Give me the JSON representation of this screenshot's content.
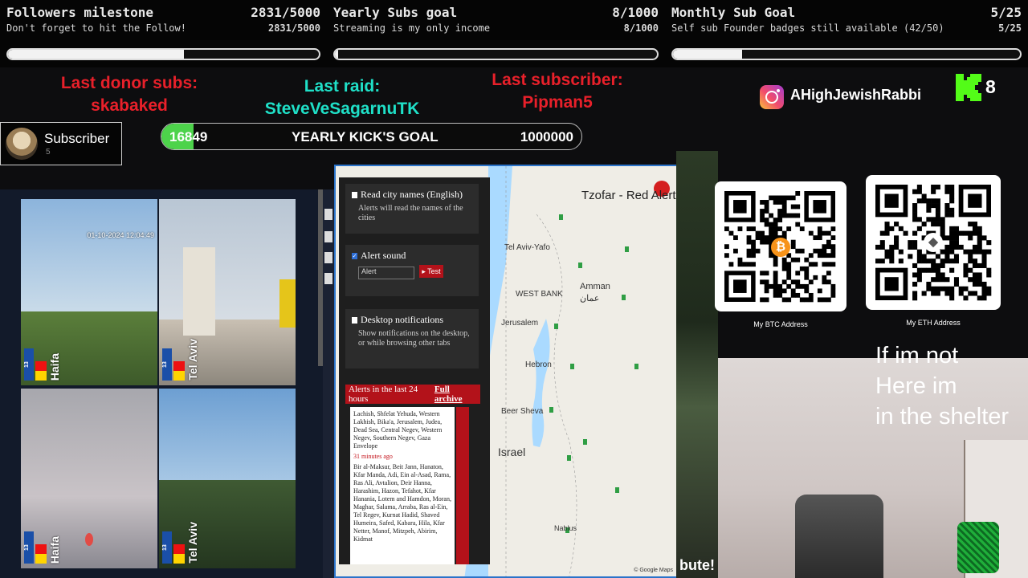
{
  "goals": [
    {
      "title": "Followers milestone",
      "count": "2831/5000",
      "subtitle": "Don't forget to hit the Follow!",
      "count2": "2831/5000",
      "progress": 0.566
    },
    {
      "title": "Yearly Subs goal",
      "count": "8/1000",
      "subtitle": "Streaming is my only income",
      "count2": "8/1000",
      "progress": 0.008
    },
    {
      "title": "Monthly Sub Goal",
      "count": "5/25",
      "subtitle": "Self sub Founder badges still available (42/50)",
      "count2": "5/25",
      "progress": 0.2
    }
  ],
  "events": {
    "donor_label": "Last donor subs:",
    "donor_name": "skabaked",
    "raid_label": "Last raid:",
    "raid_name": "SteveVeSagarnuTK",
    "sub_label": "Last subscriber:",
    "sub_name": "Pipman5"
  },
  "subscriber_card": {
    "title": "Subscriber",
    "count": "5"
  },
  "kick_goal": {
    "current": "16849",
    "label": "YEARLY KICK'S GOAL",
    "target": "1000000",
    "progress": 0.016849
  },
  "social": {
    "instagram_handle": "AHighJewishRabbi",
    "kick_count": "8",
    "icons": [
      "instagram-icon",
      "kick-logo-icon"
    ]
  },
  "cameras": [
    {
      "city": "Haifa",
      "timestamp": "01-10-2024 12:04:49"
    },
    {
      "city": "Tel Aviv",
      "timestamp": ""
    },
    {
      "city": "Haifa",
      "timestamp": ""
    },
    {
      "city": "Tel Aviv",
      "timestamp": ""
    }
  ],
  "camera_badge": "13",
  "alert_app": {
    "read_city_names": "Read city names (English)",
    "read_city_desc": "Alerts will read the names of the cities",
    "alert_sound": "Alert sound",
    "sound_select": "Alert",
    "test_button": "Test",
    "desktop_notifications": "Desktop notifications",
    "desktop_desc": "Show notifications on the desktop, or while browsing other tabs",
    "alerts_header": "Alerts in the last 24 hours",
    "full_archive": "Full archive",
    "alerts_text_1": "Lachish, Shfelat Yehuda, Western Lakhish, Bika'a, Jerusalem, Judea, Dead Sea, Central Negev, Western Negev, Southern Negev, Gaza Envelope",
    "alerts_time": "31 minutes ago",
    "alerts_text_2": "Bir al-Maksur, Beit Jann, Hanaton, Kfar Manda, Adi, Ein al-Asad, Rama, Ras Ali, Avtalion, Deir Hanna, Harashim, Hazon, Tefahot, Kfar Hanania, Lotem and Hamdon, Moran, Maghar, Salama, Arraba, Ras al-Ein, Tel Regev, Kurnat Hadid, Shaved Humeira, Safed, Kabara, Hila, Kfar Netter, Manof, Mitzpeh, Abirim, Kidmat",
    "map_title": "Tzofar - Red Alert",
    "map_labels": [
      "Tel Aviv-Yafo",
      "WEST BANK",
      "Amman",
      "عمان",
      "Jerusalem",
      "Hebron",
      "Beer Sheva",
      "Israel",
      "Nablus"
    ],
    "map_credit": "© Google Maps"
  },
  "qr": {
    "btc_label": "My BTC Address",
    "eth_label": "My ETH Address"
  },
  "webcam": {
    "shelter_line1": "If im not",
    "shelter_line2": "Here im",
    "shelter_line3": "in the shelter"
  },
  "donate_fragment": "bute!",
  "colors": {
    "accent_red": "#e8202a",
    "accent_cyan": "#1fe0c8",
    "kick_green": "#4dd34b",
    "alert_red": "#b3121a"
  }
}
